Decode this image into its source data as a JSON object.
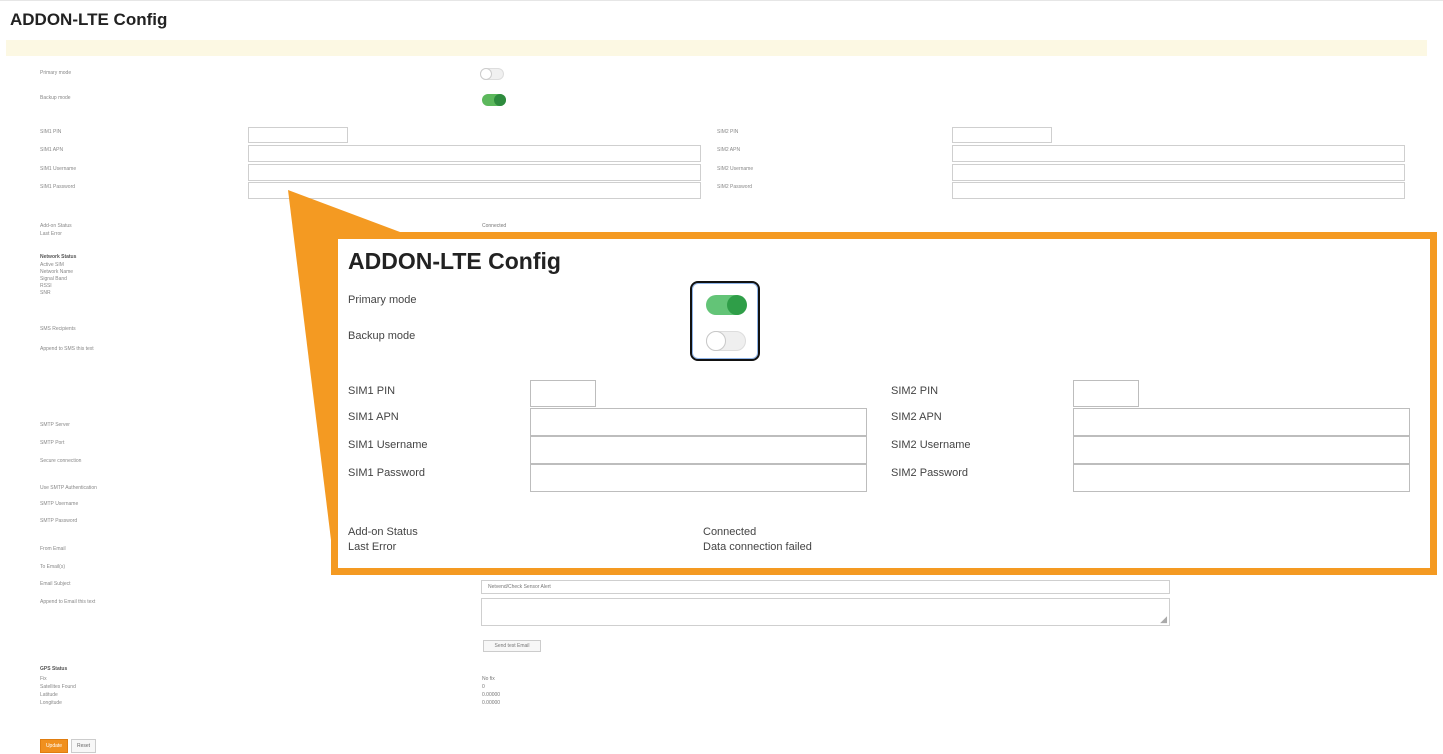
{
  "page": {
    "title": "ADDON-LTE Config"
  },
  "modes": {
    "primary_label": "Primary mode",
    "backup_label": "Backup mode",
    "primary_on": false,
    "backup_on": true
  },
  "sim1": {
    "pin_label": "SIM1 PIN",
    "apn_label": "SIM1 APN",
    "username_label": "SIM1 Username",
    "password_label": "SIM1 Password",
    "pin": "",
    "apn": "",
    "username": "",
    "password": ""
  },
  "sim2": {
    "pin_label": "SIM2 PIN",
    "apn_label": "SIM2 APN",
    "username_label": "SIM2 Username",
    "password_label": "SIM2 Password",
    "pin": "",
    "apn": "",
    "username": "",
    "password": ""
  },
  "status": {
    "addon_status_label": "Add-on Status",
    "last_error_label": "Last Error",
    "addon_status_value": "Connected",
    "last_error_value": "Data connection failed"
  },
  "network": {
    "heading": "Network Status",
    "rows": [
      "Active SIM",
      "Network Name",
      "Signal Band",
      "RSSI",
      "SNR"
    ]
  },
  "sms": {
    "recipients_label": "SMS Recipients",
    "append_label": "Append to SMS this text"
  },
  "smtp": {
    "server_label": "SMTP Server",
    "port_label": "SMTP Port",
    "secure_label": "Secure connection",
    "use_auth_label": "Use SMTP Authentication",
    "username_label": "SMTP Username",
    "password_label": "SMTP Password"
  },
  "email": {
    "from_label": "From Email",
    "to_label": "To Email(s)",
    "subject_label": "Email Subject",
    "append_label": "Append to Email this text",
    "subject_value": "Netvend/Check Sensor Alert",
    "send_test_label": "Send test Email"
  },
  "gps": {
    "heading": "GPS Status",
    "fix_label": "Fix",
    "satellites_label": "Satellites Found",
    "latitude_label": "Latitude",
    "longitude_label": "Longitude",
    "fix_value": "No fix",
    "satellites_value": "0",
    "latitude_value": "0.00000",
    "longitude_value": "0.00000"
  },
  "actions": {
    "update_label": "Update",
    "reset_label": "Reset"
  },
  "colors": {
    "accent": "#f49a22",
    "toggle_on": "#5cb85c",
    "notice": "#fcf8e3"
  },
  "zoom_callout": {
    "title": "ADDON-LTE Config",
    "primary_label": "Primary mode",
    "backup_label": "Backup mode",
    "primary_on": true,
    "backup_on": false,
    "sim1_pin": "SIM1 PIN",
    "sim1_apn": "SIM1 APN",
    "sim1_username": "SIM1 Username",
    "sim1_password": "SIM1 Password",
    "sim2_pin": "SIM2 PIN",
    "sim2_apn": "SIM2 APN",
    "sim2_username": "SIM2 Username",
    "sim2_password": "SIM2 Password",
    "addon_status_label": "Add-on Status",
    "last_error_label": "Last Error",
    "addon_status_value": "Connected",
    "last_error_value": "Data connection failed"
  }
}
